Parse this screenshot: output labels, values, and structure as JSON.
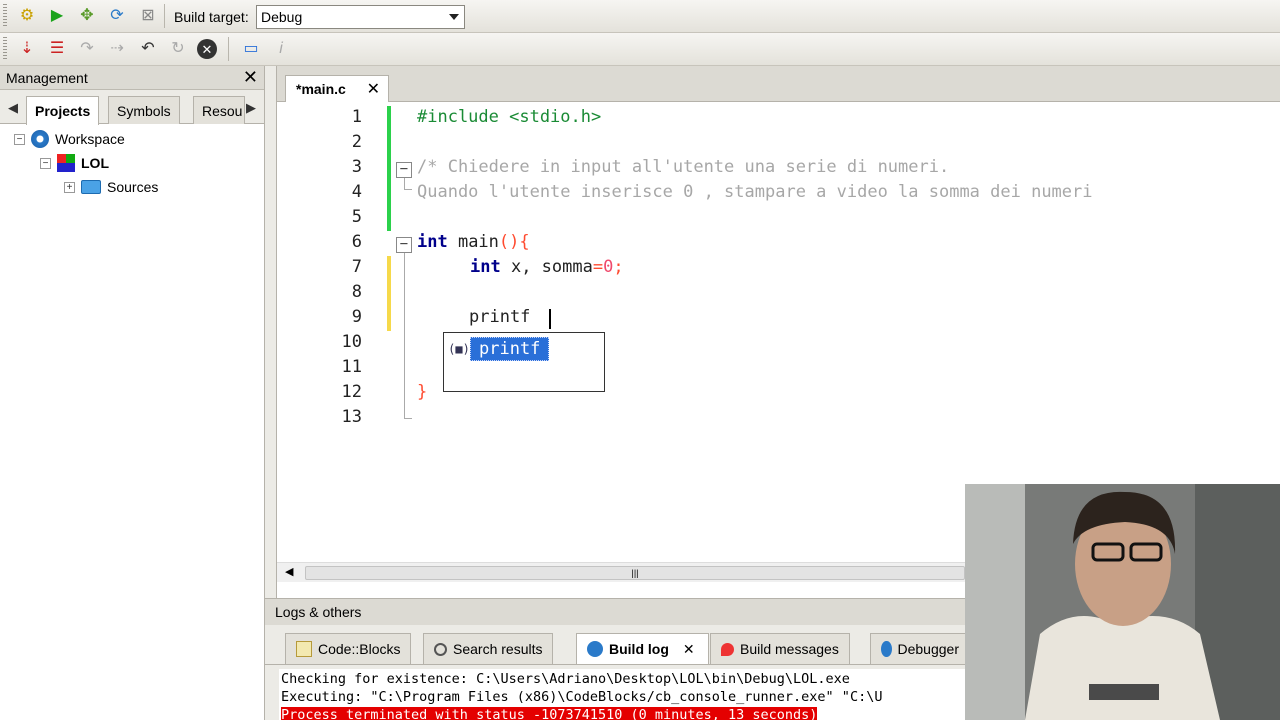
{
  "toolbar": {
    "build_target_label": "Build target:",
    "build_target_value": "Debug"
  },
  "management": {
    "title": "Management",
    "tabs": [
      "Projects",
      "Symbols",
      "Resou"
    ],
    "tree": {
      "workspace": "Workspace",
      "project": "LOL",
      "folder": "Sources"
    }
  },
  "editor": {
    "tab_label": "*main.c",
    "line_numbers": [
      "1",
      "2",
      "3",
      "4",
      "5",
      "6",
      "7",
      "8",
      "9",
      "10",
      "11",
      "12",
      "13"
    ],
    "lines": {
      "l1": "#include <stdio.h>",
      "l3": "/* Chiedere in input all'utente una serie di numeri.",
      "l4": "Quando l'utente inserisce 0 , stampare a video la somma dei numeri",
      "l6_kw": "int",
      "l6_rest": " main",
      "l6_paren": "(){",
      "l7_kw": "int",
      "l7_id": " x, somma",
      "l7_eq": "=",
      "l7_num": "0",
      "l7_semi": ";",
      "l9": "printf",
      "l12": "}"
    },
    "autocomplete": {
      "icon": "(■)",
      "item": "printf"
    }
  },
  "logs": {
    "title": "Logs & others",
    "tabs": [
      "Code::Blocks",
      "Search results",
      "Build log",
      "Build messages",
      "Debugger"
    ],
    "lines": [
      "Checking for existence: C:\\Users\\Adriano\\Desktop\\LOL\\bin\\Debug\\LOL.exe",
      "Executing: \"C:\\Program Files (x86)\\CodeBlocks/cb_console_runner.exe\" \"C:\\U",
      "Process terminated with status -1073741510 (0 minutes, 13 seconds)"
    ]
  },
  "colors": {
    "preprocessor": "#1a8b35",
    "comment": "#a7a7a7",
    "keyword": "#00008b",
    "operator": "#ff4a2f",
    "selection": "#2a6fd8",
    "error_bg": "#e40000"
  }
}
